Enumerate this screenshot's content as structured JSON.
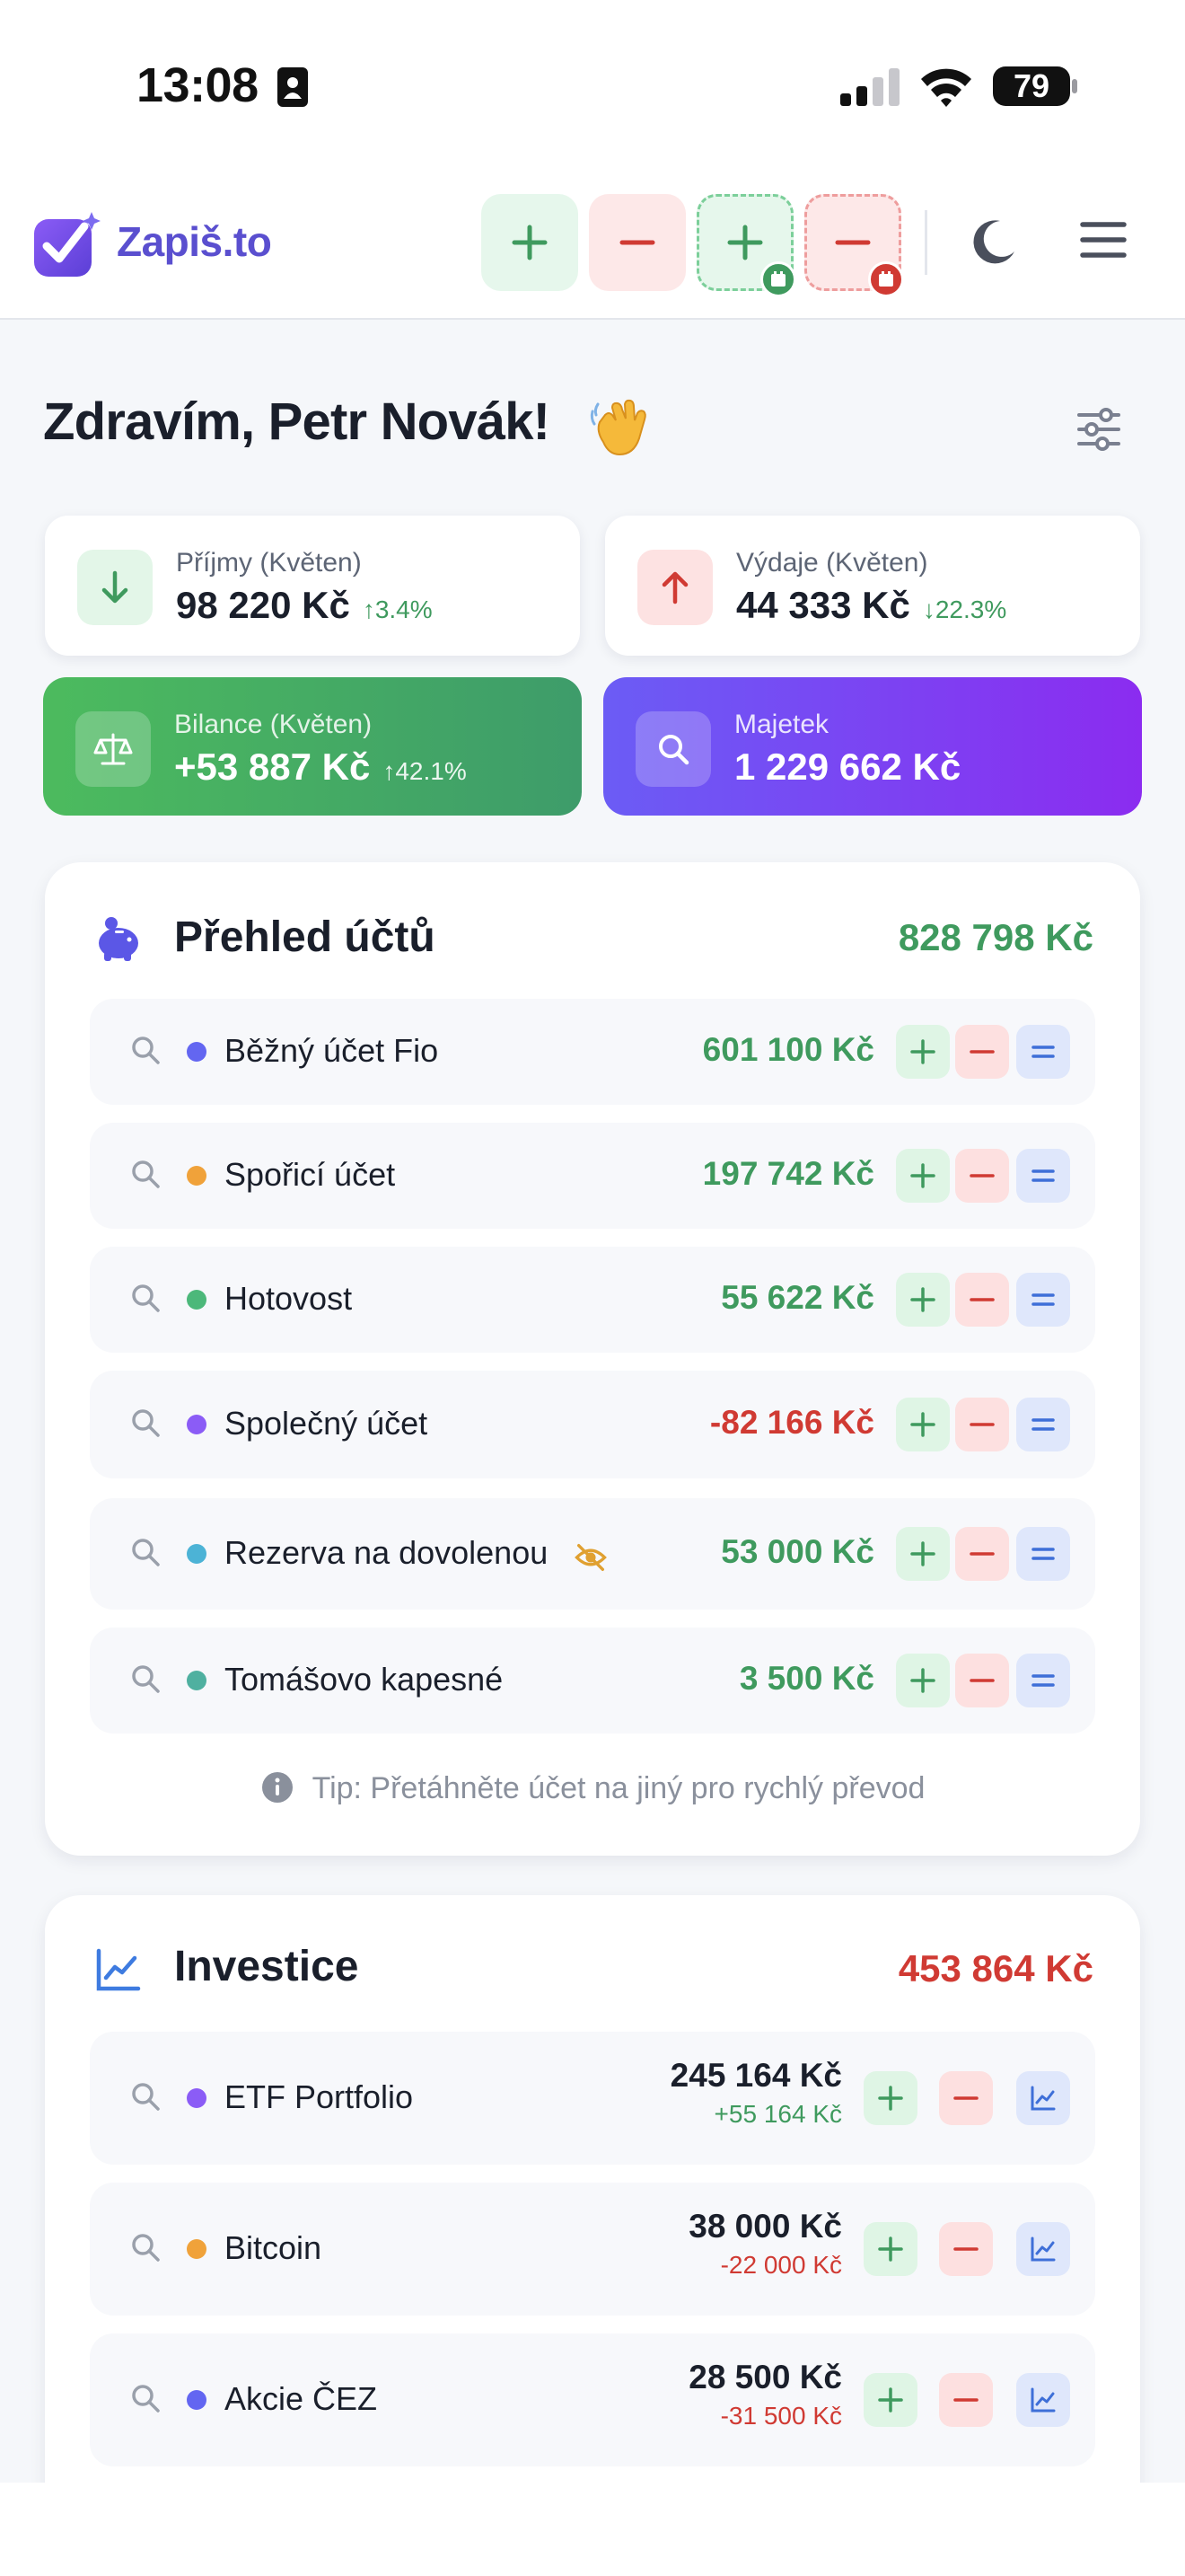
{
  "status_bar": {
    "time": "13:08",
    "battery": "79",
    "icons": [
      "id-card-icon",
      "cellular-signal-icon",
      "wifi-icon",
      "battery-icon"
    ]
  },
  "app": {
    "logo_text": "Zapiš.to",
    "quick_actions": [
      "add-income",
      "add-expense",
      "add-scheduled-income",
      "add-scheduled-expense"
    ],
    "icons": [
      "moon-icon",
      "menu-icon"
    ]
  },
  "greeting": {
    "text": "Zdravím, Petr Novák!",
    "emoji_icon": "waving-hand-icon"
  },
  "stats": {
    "income": {
      "label": "Příjmy (Květen)",
      "value": "98 220 Kč",
      "change": "↑3.4%"
    },
    "expenses": {
      "label": "Výdaje (Květen)",
      "value": "44 333 Kč",
      "change": "↓22.3%"
    },
    "balance": {
      "label": "Bilance (Květen)",
      "value": "+53 887 Kč",
      "change": "↑42.1%"
    },
    "assets": {
      "label": "Majetek",
      "value": "1 229 662 Kč"
    }
  },
  "accounts": {
    "title": "Přehled účtů",
    "total": "828 798 Kč",
    "items": [
      {
        "name": "Běžný účet Fio",
        "amount": "601 100 Kč",
        "dot_color": "#6366f1",
        "amount_color": "#3f9a5e"
      },
      {
        "name": "Spořicí účet",
        "amount": "197 742 Kč",
        "dot_color": "#f0a23a",
        "amount_color": "#3f9a5e"
      },
      {
        "name": "Hotovost",
        "amount": "55 622 Kč",
        "dot_color": "#4cb87a",
        "amount_color": "#3f9a5e"
      },
      {
        "name": "Společný účet",
        "amount": "-82 166 Kč",
        "dot_color": "#8b5cf6",
        "amount_color": "#d03a33"
      },
      {
        "name": "Rezerva na dovolenou",
        "amount": "53 000 Kč",
        "dot_color": "#4cb3d6",
        "amount_color": "#3f9a5e",
        "hidden_icon": "eye-off-icon"
      },
      {
        "name": "Tomášovo kapesné",
        "amount": "3 500 Kč",
        "dot_color": "#4fb0a0",
        "amount_color": "#3f9a5e"
      }
    ],
    "tip": "Tip: Přetáhněte účet na jiný pro rychlý převod"
  },
  "investments": {
    "title": "Investice",
    "total": "453 864 Kč",
    "items": [
      {
        "name": "ETF Portfolio",
        "amount": "245 164 Kč",
        "change": "+55 164 Kč",
        "dot_color": "#8b5cf6",
        "change_color": "#3f9a5e"
      },
      {
        "name": "Bitcoin",
        "amount": "38 000 Kč",
        "change": "-22 000 Kč",
        "dot_color": "#f0a23a",
        "change_color": "#d03a33"
      },
      {
        "name": "Akcie ČEZ",
        "amount": "28 500 Kč",
        "change": "-31 500 Kč",
        "dot_color": "#6366f1",
        "change_color": "#d03a33"
      }
    ]
  },
  "colors": {
    "positive": "#3f9a5e",
    "negative": "#d03a33",
    "brand": "#5a4fcf"
  }
}
